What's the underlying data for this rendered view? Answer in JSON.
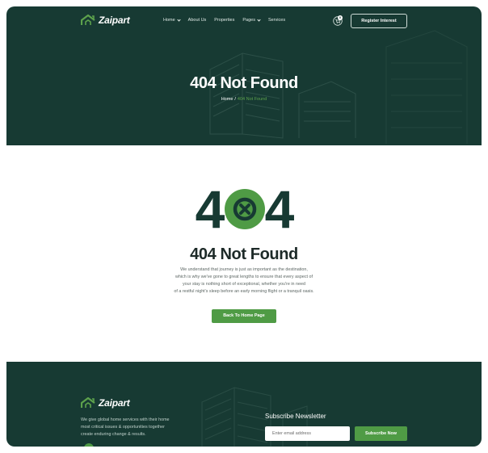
{
  "brand": {
    "name": "Zaipart",
    "accent": "#4f9b45",
    "dark": "#173a33"
  },
  "nav": {
    "items": [
      {
        "label": "Home",
        "has_dropdown": true
      },
      {
        "label": "About Us",
        "has_dropdown": false
      },
      {
        "label": "Properties",
        "has_dropdown": false
      },
      {
        "label": "Pages",
        "has_dropdown": true
      },
      {
        "label": "Services",
        "has_dropdown": false
      }
    ],
    "cart_icon": "cart-icon",
    "cart_count": "0",
    "register_label": "Register Interest"
  },
  "hero": {
    "title": "404 Not Found",
    "breadcrumb": {
      "home": "Home",
      "separator": "/",
      "current": "404 Not Found"
    }
  },
  "error": {
    "graphic_left": "4",
    "graphic_right": "4",
    "graphic_icon": "close-icon",
    "title": "404 Not Found",
    "description_lines": [
      "We understand that journey is just as important as the destination,",
      "which is why we've gone to great lengths to ensure that every aspect of",
      "your stay is nothing short of exceptional, whether you're in need",
      "of a restful night's sleep before an early morning flight or a tranquil oasis."
    ],
    "button_label": "Back To Home Page"
  },
  "footer": {
    "description_lines": [
      "We give global home services with their home",
      "most critical issues & opportunities together",
      "create enduring change & results."
    ],
    "newsletter_title": "Subscribe Newsletter",
    "email_placeholder": "Enter email address",
    "subscribe_label": "Subscribe Now"
  }
}
